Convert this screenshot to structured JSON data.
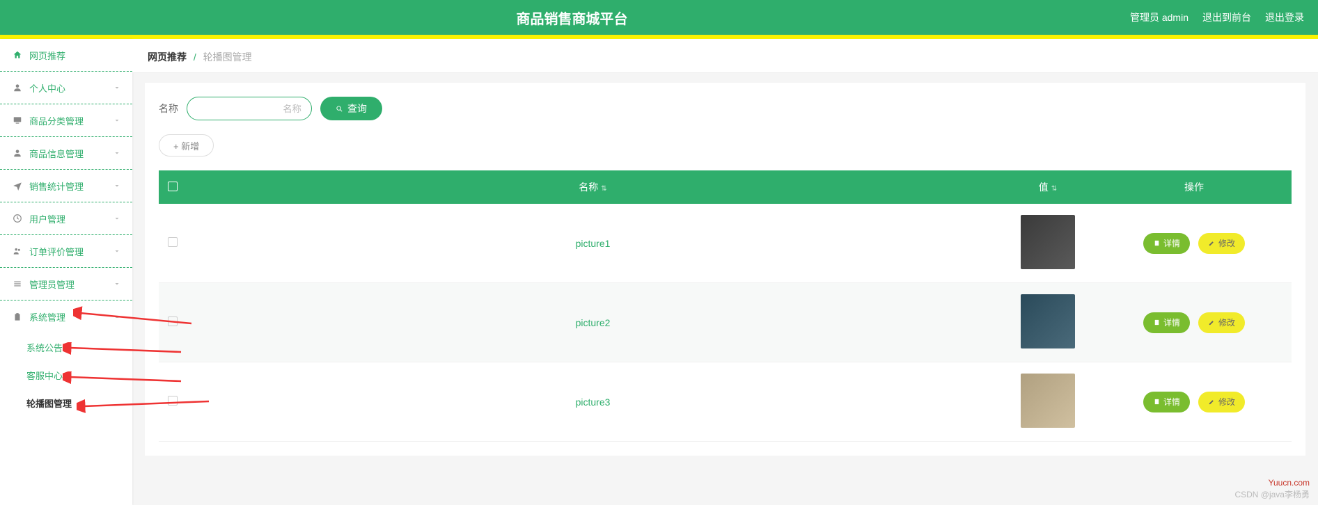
{
  "header": {
    "title": "商品销售商城平台",
    "actions": {
      "admin": "管理员 admin",
      "exit_front": "退出到前台",
      "logout": "退出登录"
    }
  },
  "sidebar": {
    "items": [
      {
        "label": "网页推荐"
      },
      {
        "label": "个人中心"
      },
      {
        "label": "商品分类管理"
      },
      {
        "label": "商品信息管理"
      },
      {
        "label": "销售统计管理"
      },
      {
        "label": "用户管理"
      },
      {
        "label": "订单评价管理"
      },
      {
        "label": "管理员管理"
      },
      {
        "label": "系统管理"
      }
    ],
    "subs": [
      {
        "label": "系统公告"
      },
      {
        "label": "客服中心"
      },
      {
        "label": "轮播图管理"
      }
    ]
  },
  "breadcrumb": {
    "root": "网页推荐",
    "leaf": "轮播图管理"
  },
  "search": {
    "label": "名称",
    "placeholder": "名称",
    "button": "查询"
  },
  "add": {
    "label": "+ 新增"
  },
  "table": {
    "headers": {
      "name": "名称",
      "value": "值",
      "op": "操作"
    },
    "rows": [
      {
        "name": "picture1"
      },
      {
        "name": "picture2"
      },
      {
        "name": "picture3"
      }
    ],
    "buttons": {
      "detail": "详情",
      "edit": "修改"
    }
  },
  "watermark": {
    "site": "Yuucn.com",
    "csdn": "CSDN @java李杨勇"
  }
}
